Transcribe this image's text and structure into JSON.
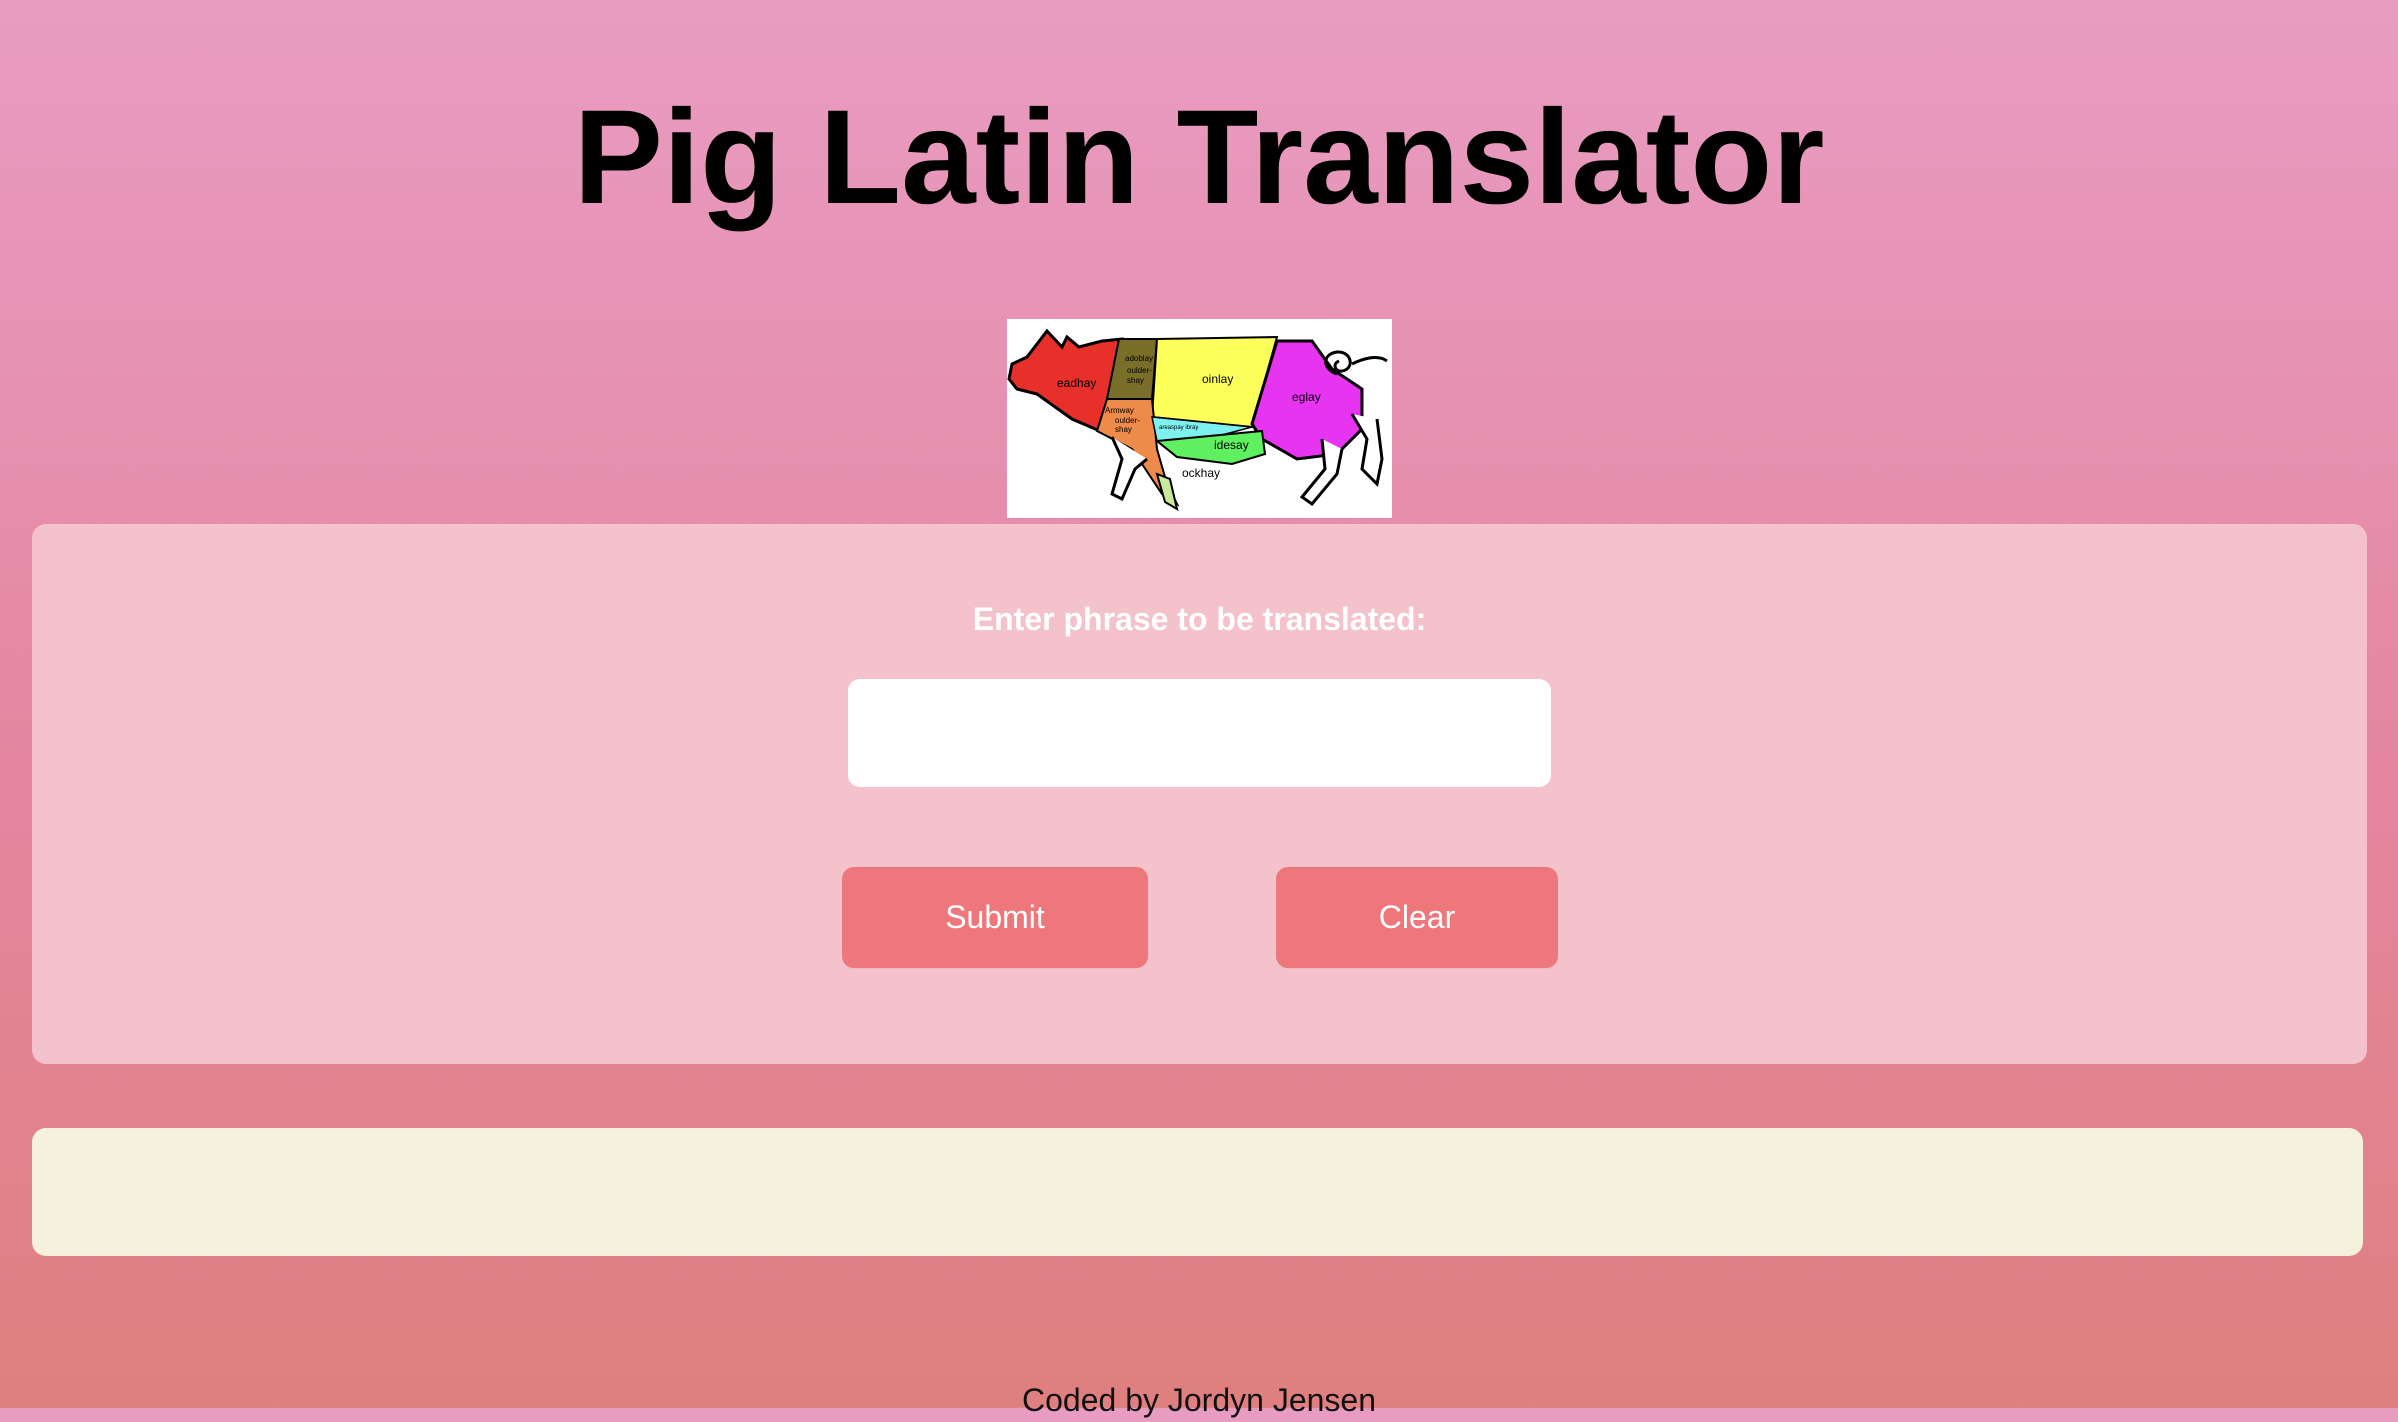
{
  "header": {
    "title": "Pig Latin Translator"
  },
  "pig_image": {
    "icon": "pig-cuts-diagram-icon",
    "labels": {
      "head": "eadhay",
      "shoulder_top": "adoblay",
      "shoulder_mid": "oulder-",
      "shoulder_low": "shay",
      "loin": "oinlay",
      "leg": "eglay",
      "arm_top": "Armway",
      "arm_mid": "oulder-",
      "arm_low": "shay",
      "spare": "areaspay ibray",
      "side": "idesay",
      "hock": "ockhay"
    }
  },
  "translator": {
    "prompt": "Enter phrase to be translated:",
    "input_value": "",
    "input_placeholder": "",
    "submit_label": "Submit",
    "clear_label": "Clear"
  },
  "output": {
    "text": ""
  },
  "footer": {
    "credit": "Coded by Jordyn Jensen"
  },
  "colors": {
    "panel": "#f4c2cb",
    "button": "#ed777b",
    "output_bg": "#f4f2dc",
    "title": "#000000"
  }
}
